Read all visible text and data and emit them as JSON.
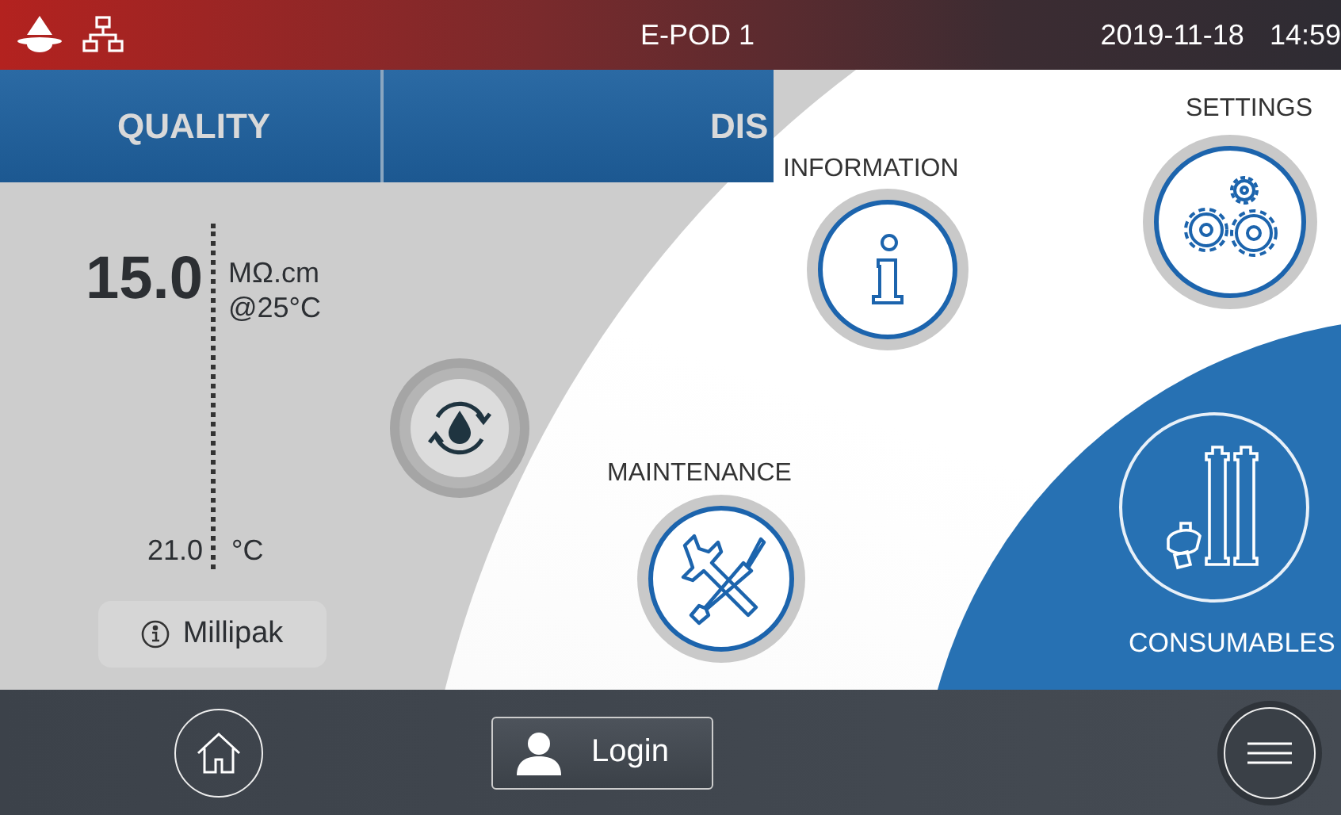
{
  "status_bar": {
    "title": "E-POD 1",
    "date": "2019-11-18",
    "time": "14:59"
  },
  "tabs": [
    {
      "label": "QUALITY"
    },
    {
      "label": "DIS"
    }
  ],
  "quality": {
    "resistivity": "15.0",
    "resistivity_unit": "MΩ.cm",
    "reference": "@25°C",
    "temperature": "21.0",
    "temperature_unit": "°C",
    "cartridge": "Millipak"
  },
  "menu": [
    {
      "kind": "information",
      "label": "INFORMATION",
      "selected": false
    },
    {
      "kind": "settings",
      "label": "SETTINGS",
      "selected": false
    },
    {
      "kind": "maintenance",
      "label": "MAINTENANCE",
      "selected": false
    },
    {
      "kind": "consumables",
      "label": "CONSUMABLES",
      "selected": true
    }
  ],
  "bottom_bar": {
    "login": "Login"
  }
}
